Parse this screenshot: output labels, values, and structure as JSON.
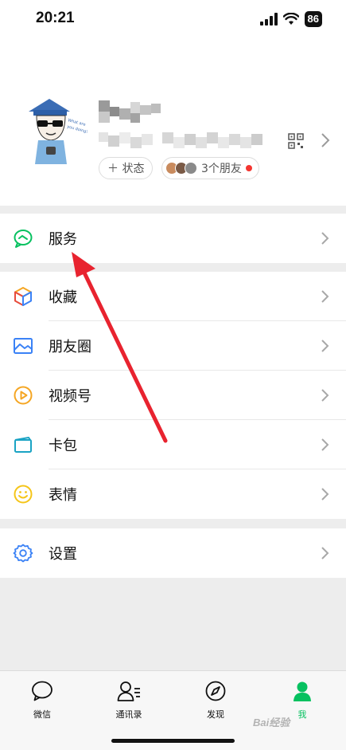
{
  "status_bar": {
    "time": "20:21",
    "battery": "86"
  },
  "profile": {
    "status_chip": "＋ 状态",
    "friends_chip": "3个朋友"
  },
  "menu": {
    "services": "服务",
    "favorites": "收藏",
    "moments": "朋友圈",
    "channels": "视频号",
    "cards": "卡包",
    "stickers": "表情",
    "settings": "设置"
  },
  "tabbar": {
    "chats": "微信",
    "contacts": "通讯录",
    "discover": "发现",
    "me": "我"
  },
  "watermark": "Bai经验",
  "colors": {
    "brand_green": "#07c160",
    "annotation_red": "#e8232f",
    "badge_red": "#f43530"
  }
}
